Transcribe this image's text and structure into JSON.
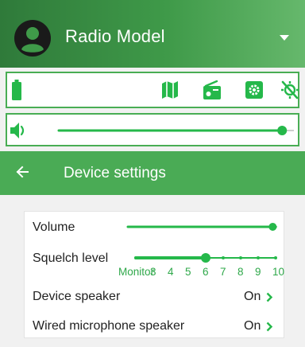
{
  "app": {
    "title": "Radio Model"
  },
  "icons": {
    "avatar": "account-circle-icon",
    "dropdown": "caret-down-icon",
    "battery": "battery-icon",
    "map": "map-icon",
    "radio": "radio-icon",
    "settings": "settings-icon",
    "location_off": "location-off-icon",
    "volume": "volume-icon",
    "back": "back-arrow-icon",
    "chevron": "chevron-right-icon"
  },
  "colors": {
    "accent": "#25b84a",
    "header": "#3f9a49",
    "settings_header": "#4aab55"
  },
  "main_volume": {
    "level": 0.95
  },
  "settings": {
    "title": "Device settings",
    "volume": {
      "label": "Volume",
      "level": 0.97
    },
    "squelch": {
      "label": "Squelch level",
      "selected_index": 4,
      "ticks": [
        "Monitor",
        "3",
        "4",
        "5",
        "6",
        "7",
        "8",
        "9",
        "10"
      ]
    },
    "device_speaker": {
      "label": "Device speaker",
      "value": "On"
    },
    "wired_mic_speaker": {
      "label": "Wired microphone speaker",
      "value": "On"
    }
  }
}
